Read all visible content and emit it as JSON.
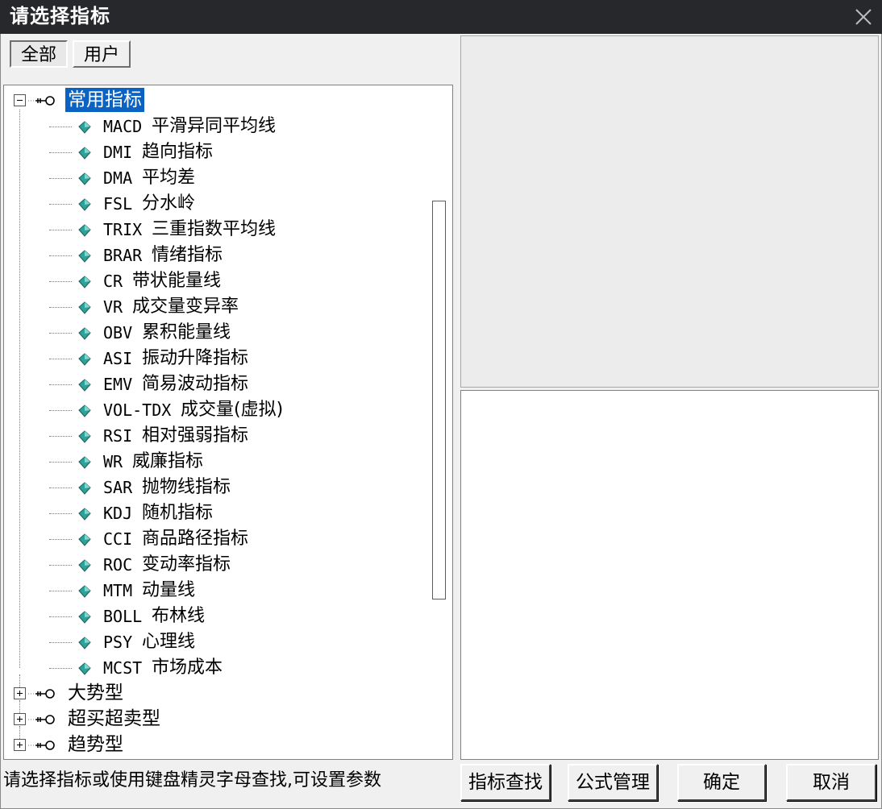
{
  "window": {
    "title": "请选择指标"
  },
  "tabs": [
    {
      "label": "全部",
      "active": true
    },
    {
      "label": "用户",
      "active": false
    }
  ],
  "tree": {
    "groups": [
      {
        "label": "常用指标",
        "expanded": true,
        "selected": true
      },
      {
        "label": "大势型",
        "expanded": false
      },
      {
        "label": "超买超卖型",
        "expanded": false
      },
      {
        "label": "趋势型",
        "expanded": false
      }
    ],
    "items": [
      {
        "code": "MACD",
        "name": "平滑异同平均线"
      },
      {
        "code": "DMI",
        "name": "趋向指标"
      },
      {
        "code": "DMA",
        "name": "平均差"
      },
      {
        "code": "FSL",
        "name": "分水岭"
      },
      {
        "code": "TRIX",
        "name": "三重指数平均线"
      },
      {
        "code": "BRAR",
        "name": "情绪指标"
      },
      {
        "code": "CR",
        "name": "带状能量线"
      },
      {
        "code": "VR",
        "name": "成交量变异率"
      },
      {
        "code": "OBV",
        "name": "累积能量线"
      },
      {
        "code": "ASI",
        "name": "振动升降指标"
      },
      {
        "code": "EMV",
        "name": "简易波动指标"
      },
      {
        "code": "VOL-TDX",
        "name": "成交量(虚拟)"
      },
      {
        "code": "RSI",
        "name": "相对强弱指标"
      },
      {
        "code": "WR",
        "name": "威廉指标"
      },
      {
        "code": "SAR",
        "name": "抛物线指标"
      },
      {
        "code": "KDJ",
        "name": "随机指标"
      },
      {
        "code": "CCI",
        "name": "商品路径指标"
      },
      {
        "code": "ROC",
        "name": "变动率指标"
      },
      {
        "code": "MTM",
        "name": "动量线"
      },
      {
        "code": "BOLL",
        "name": "布林线"
      },
      {
        "code": "PSY",
        "name": "心理线"
      },
      {
        "code": "MCST",
        "name": "市场成本"
      }
    ]
  },
  "status": {
    "hint": "请选择指标或使用键盘精灵字母查找,可设置参数"
  },
  "buttons": {
    "search": "指标查找",
    "formula": "公式管理",
    "ok": "确定",
    "cancel": "取消"
  },
  "colors": {
    "titlebar": "#26282b",
    "selection": "#0a62c2",
    "gem": "#2aa39a"
  }
}
